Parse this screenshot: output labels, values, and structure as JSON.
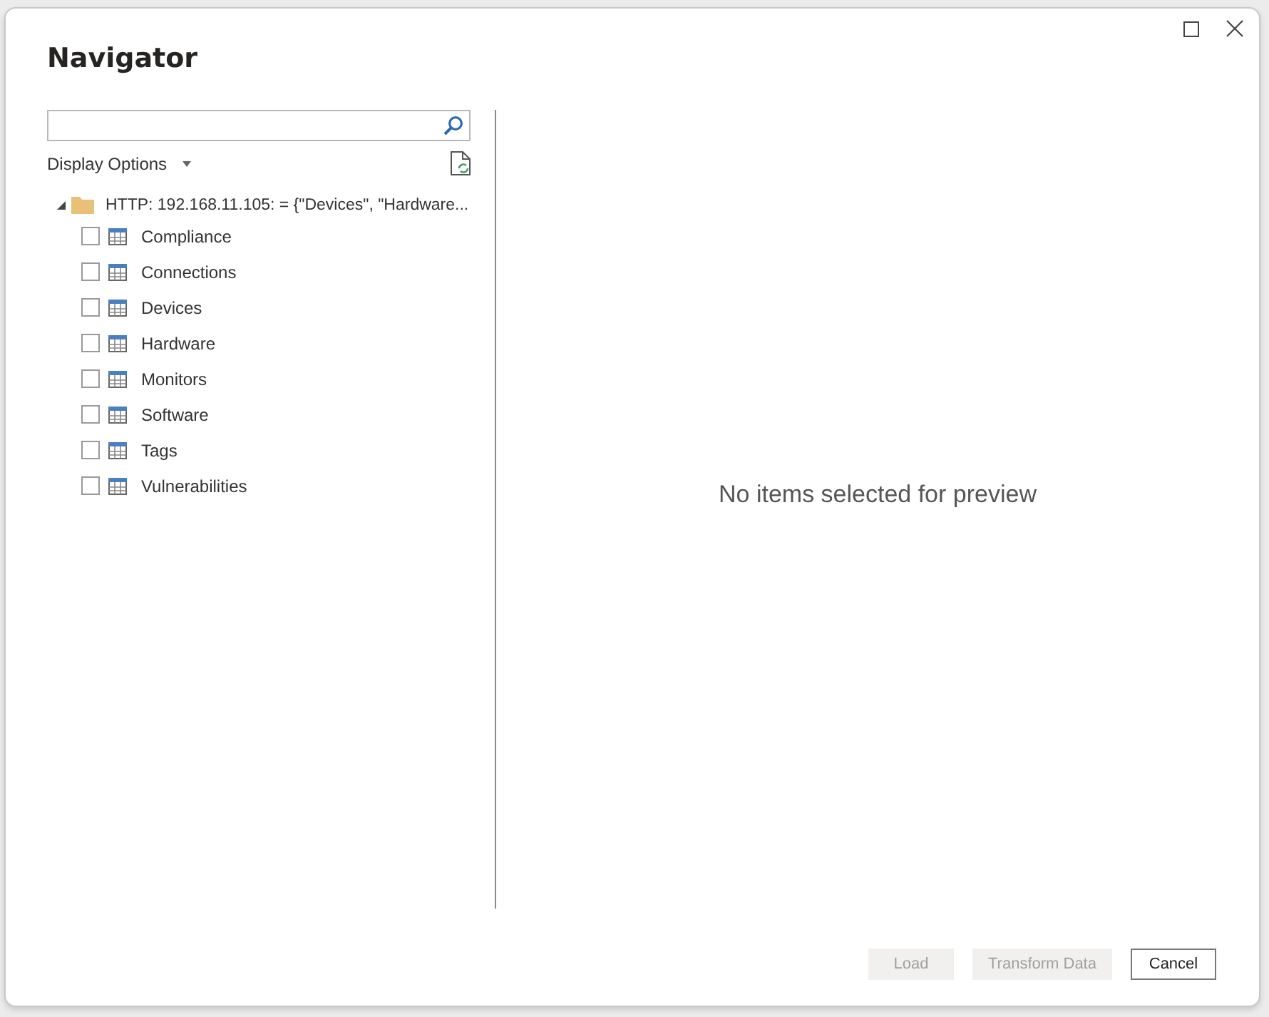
{
  "window": {
    "title": "Navigator"
  },
  "display_options": {
    "label": "Display Options"
  },
  "tree": {
    "label": "HTTP: 192.168.11.105: = {\"Devices\", \"Hardware...",
    "expanded": true,
    "children": [
      {
        "label": "Compliance",
        "checked": false
      },
      {
        "label": "Connections",
        "checked": false
      },
      {
        "label": "Devices",
        "checked": false
      },
      {
        "label": "Hardware",
        "checked": false
      },
      {
        "label": "Monitors",
        "checked": false
      },
      {
        "label": "Software",
        "checked": false
      },
      {
        "label": "Tags",
        "checked": false
      },
      {
        "label": "Vulnerabilities",
        "checked": false
      }
    ]
  },
  "preview": {
    "message": "No items selected for preview"
  },
  "buttons": [
    {
      "label": "Load",
      "disabled": true
    },
    {
      "label": "Transform Data",
      "disabled": true
    },
    {
      "label": "Cancel",
      "disabled": false
    }
  ]
}
